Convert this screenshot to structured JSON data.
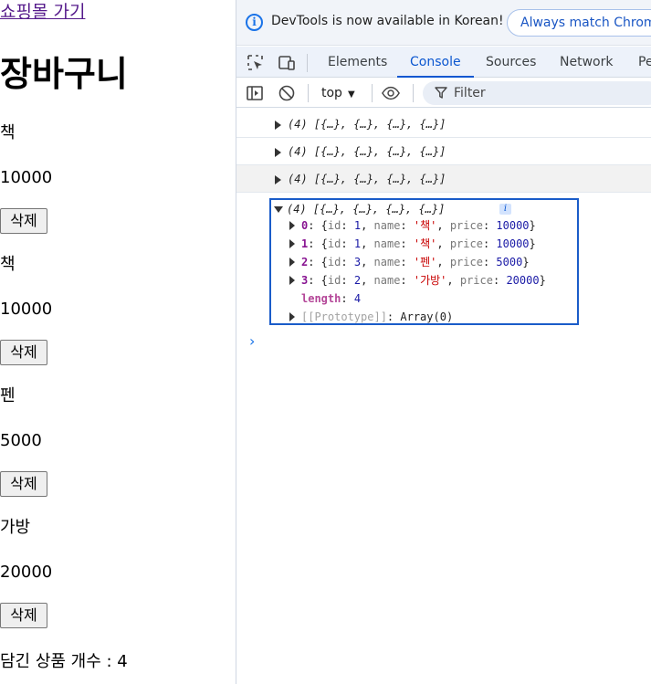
{
  "page": {
    "link_text": "쇼핑몰 가기",
    "heading": "장바구니",
    "items": [
      {
        "name": "책",
        "price": "10000",
        "delete_label": "삭제"
      },
      {
        "name": "책",
        "price": "10000",
        "delete_label": "삭제"
      },
      {
        "name": "펜",
        "price": "5000",
        "delete_label": "삭제"
      },
      {
        "name": "가방",
        "price": "20000",
        "delete_label": "삭제"
      }
    ],
    "count_text": "담긴 상품 개수 : 4"
  },
  "devtools": {
    "infobar": {
      "message": "DevTools is now available in Korean!",
      "button_label": "Always match Chrome's language"
    },
    "tabs": [
      "Elements",
      "Console",
      "Sources",
      "Network",
      "Performance"
    ],
    "active_tab": "Console",
    "toolbar": {
      "context": "top",
      "filter_placeholder": "Filter"
    },
    "console": {
      "collapsed_logs": [
        "(4) [{…}, {…}, {…}, {…}]",
        "(4) [{…}, {…}, {…}, {…}]",
        "(4) [{…}, {…}, {…}, {…}]"
      ],
      "expanded_summary": "(4) [{…}, {…}, {…}, {…}]",
      "info_badge": "i",
      "entries": [
        {
          "index": "0",
          "id": "1",
          "name": "'책'",
          "price": "10000"
        },
        {
          "index": "1",
          "id": "1",
          "name": "'책'",
          "price": "10000"
        },
        {
          "index": "2",
          "id": "3",
          "name": "'펜'",
          "price": "5000"
        },
        {
          "index": "3",
          "id": "2",
          "name": "'가방'",
          "price": "20000"
        }
      ],
      "length_key": "length",
      "length_value": "4",
      "prototype_key": "[[Prototype]]",
      "prototype_value": "Array(0)",
      "prompt": "›"
    }
  },
  "colors": {
    "accent": "#0b57d0",
    "link_visited": "#551a8b",
    "string": "#c80000",
    "number": "#1a1aa6",
    "index_key": "#881391"
  }
}
